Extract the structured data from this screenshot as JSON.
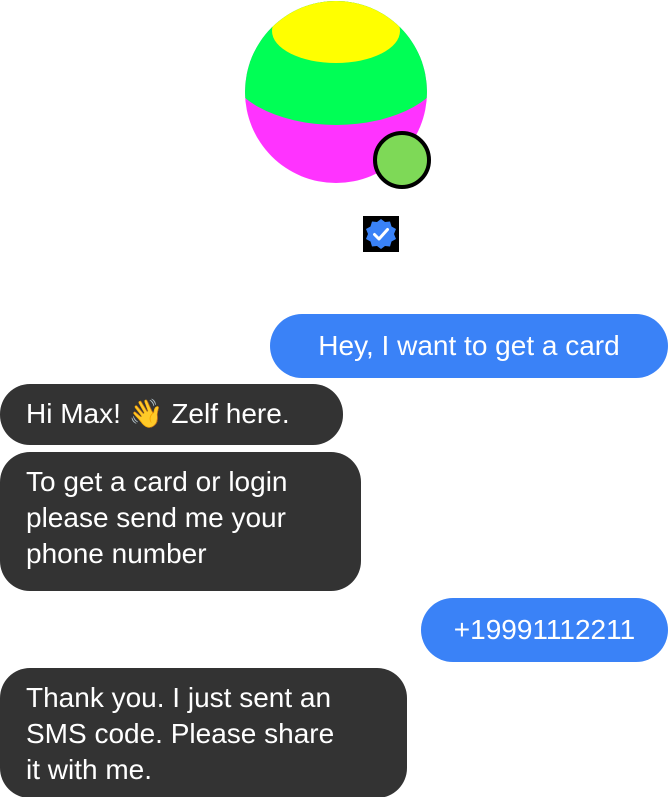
{
  "header": {
    "avatar_icon": "gradient-sphere-avatar",
    "status_color": "#7ED957",
    "verified_icon": "verified-badge-icon"
  },
  "colors": {
    "user_bubble": "#3A82F7",
    "bot_bubble": "#333333",
    "avatar_top": "#FFFF00",
    "avatar_middle": "#00FF55",
    "avatar_bottom": "#FF33FF"
  },
  "messages": [
    {
      "sender": "user",
      "text": "Hey, I want to get a card"
    },
    {
      "sender": "bot",
      "text": "Hi Max! 👋 Zelf here."
    },
    {
      "sender": "bot",
      "text": "To get a card or login\nplease send me your\nphone number"
    },
    {
      "sender": "user",
      "text": "+19991112211"
    },
    {
      "sender": "bot",
      "text": "Thank you. I just sent an\nSMS code. Please share\nit with me."
    }
  ]
}
